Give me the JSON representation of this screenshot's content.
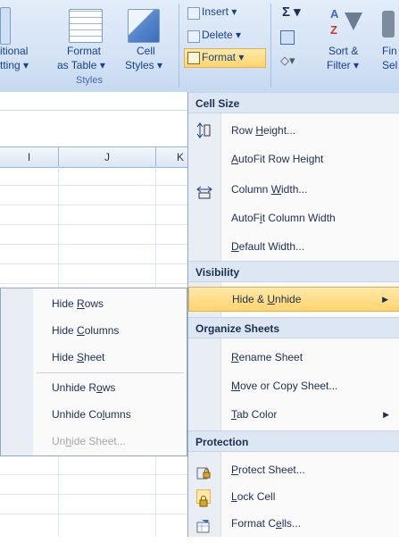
{
  "ribbon": {
    "styles": {
      "conditional_line1": "itional",
      "conditional_line2": "tting ▾",
      "format_table_line1": "Format",
      "format_table_line2": "as Table ▾",
      "cell_styles_line1": "Cell",
      "cell_styles_line2": "Styles ▾",
      "group_label": "Styles"
    },
    "cells": {
      "insert_label": "Insert ▾",
      "delete_label": "Delete ▾",
      "format_label": "Format ▾"
    },
    "editing": {
      "sigma_label": "Σ ▾",
      "sort_line1": "Sort &",
      "sort_line2": "Filter ▾",
      "find_line1": "Fin",
      "find_line2": "Sel"
    }
  },
  "grid": {
    "columns": [
      "I",
      "J",
      "K"
    ]
  },
  "format_menu": {
    "sections": {
      "cell_size": "Cell Size",
      "visibility": "Visibility",
      "organize": "Organize Sheets",
      "protection": "Protection"
    },
    "items": {
      "row_height": {
        "pre": "Row ",
        "key": "H",
        "post": "eight..."
      },
      "autofit_row_height": {
        "pre": "",
        "key": "A",
        "post": "utoFit Row Height"
      },
      "column_width": {
        "pre": "Column ",
        "key": "W",
        "post": "idth..."
      },
      "autofit_column_width": {
        "pre": "AutoF",
        "key": "i",
        "post": "t Column Width"
      },
      "default_width": {
        "pre": "",
        "key": "D",
        "post": "efault Width..."
      },
      "hide_unhide": {
        "pre": "Hide & ",
        "key": "U",
        "post": "nhide"
      },
      "rename_sheet": {
        "pre": "",
        "key": "R",
        "post": "ename Sheet"
      },
      "move_copy_sheet": {
        "pre": "",
        "key": "M",
        "post": "ove or Copy Sheet..."
      },
      "tab_color": {
        "pre": "",
        "key": "T",
        "post": "ab Color"
      },
      "protect_sheet": {
        "pre": "",
        "key": "P",
        "post": "rotect Sheet..."
      },
      "lock_cell": {
        "pre": "",
        "key": "L",
        "post": "ock Cell"
      },
      "format_cells": {
        "pre": "Format C",
        "key": "e",
        "post": "lls..."
      }
    }
  },
  "submenu": {
    "hide_rows": {
      "pre": "Hide ",
      "key": "R",
      "post": "ows"
    },
    "hide_columns": {
      "pre": "Hide ",
      "key": "C",
      "post": "olumns"
    },
    "hide_sheet": {
      "pre": "Hide ",
      "key": "S",
      "post": "heet"
    },
    "unhide_rows": {
      "pre": "Unhide R",
      "key": "o",
      "post": "ws"
    },
    "unhide_columns": {
      "pre": "Unhide Co",
      "key": "l",
      "post": "umns"
    },
    "unhide_sheet": {
      "pre": "Un",
      "key": "h",
      "post": "ide Sheet..."
    }
  },
  "colors": {
    "highlight": "#ffd46e",
    "ribbon_bg": "#d5e3f5",
    "menu_header": "#dde7f4",
    "disabled_text": "#a6a6a6"
  }
}
